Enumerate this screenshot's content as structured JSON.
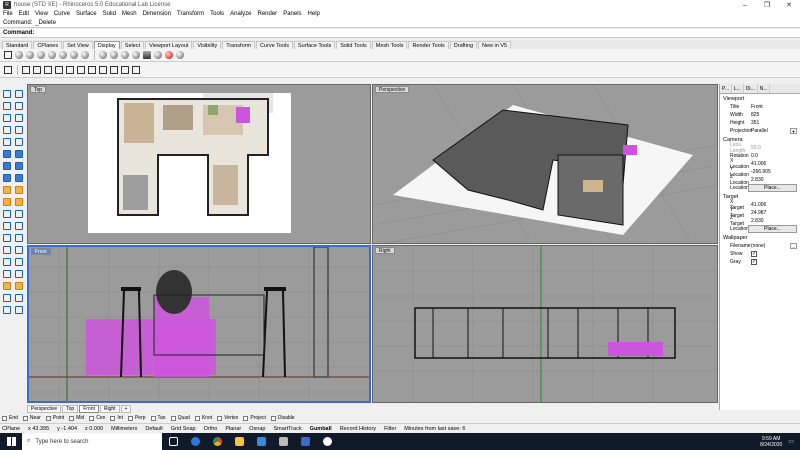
{
  "titlebar": {
    "app_icon": "rhino-icon",
    "title": "house (STD XE) - Rhinoceros 5.0 Educational Lab License",
    "minimize": "–",
    "maximize": "❐",
    "close": "✕"
  },
  "menu": [
    "File",
    "Edit",
    "View",
    "Curve",
    "Surface",
    "Solid",
    "Mesh",
    "Dimension",
    "Transform",
    "Tools",
    "Analyze",
    "Render",
    "Panels",
    "Help"
  ],
  "command": {
    "history_label": "Command:",
    "history_value": "_Delete",
    "prompt_label": "Command:",
    "prompt_value": ""
  },
  "toolbar_tabs": [
    "Standard",
    "CPlanes",
    "Set View",
    "Display",
    "Select",
    "Viewport Layout",
    "Visibility",
    "Transform",
    "Curve Tools",
    "Surface Tools",
    "Solid Tools",
    "Mesh Tools",
    "Render Tools",
    "Drafting",
    "New in V5"
  ],
  "active_toolbar_tab": "Display",
  "viewports": {
    "top": {
      "title": "Top"
    },
    "perspective": {
      "title": "Perspective"
    },
    "front": {
      "title": "Front"
    },
    "right": {
      "title": "Right"
    }
  },
  "viewport_tabs": [
    "Perspective",
    "Top",
    "Front",
    "Right",
    "+"
  ],
  "panel": {
    "tabs": [
      "P...",
      "L...",
      "Di...",
      "N..."
    ],
    "viewport_header": "Viewport",
    "viewport_props": [
      {
        "k": "Title",
        "v": "Front"
      },
      {
        "k": "Width",
        "v": "825"
      },
      {
        "k": "Height",
        "v": "351"
      },
      {
        "k": "Projection",
        "v": "Parallel"
      }
    ],
    "camera_header": "Camera",
    "camera_props": [
      {
        "k": "Lens Length",
        "v": "50.0"
      },
      {
        "k": "Rotation",
        "v": "0.0"
      },
      {
        "k": "X Location",
        "v": "41.006"
      },
      {
        "k": "Y Location",
        "v": "-266.905"
      },
      {
        "k": "Z Location",
        "v": "2.830"
      },
      {
        "k": "Location",
        "v": "Place..."
      }
    ],
    "target_header": "Target",
    "target_props": [
      {
        "k": "X Target",
        "v": "41.006"
      },
      {
        "k": "Y Target",
        "v": "24.987"
      },
      {
        "k": "Z Target",
        "v": "2.830"
      },
      {
        "k": "Location",
        "v": "Place..."
      }
    ],
    "wallpaper_header": "Wallpaper",
    "wallpaper_props": [
      {
        "k": "Filename",
        "v": "(none)"
      },
      {
        "k": "Show",
        "v": "✓"
      },
      {
        "k": "Gray",
        "v": "✓"
      }
    ]
  },
  "osnaps": [
    "End",
    "Near",
    "Point",
    "Mid",
    "Cen",
    "Int",
    "Perp",
    "Tan",
    "Quad",
    "Knot",
    "Vertex",
    "Project",
    "Disable"
  ],
  "status": {
    "cplane": "CPlane",
    "x": "x 43.395",
    "y": "y -1.404",
    "z": "z 0.000",
    "units": "Millimeters",
    "layer": "Default",
    "grid_snap": "Grid Snap",
    "ortho": "Ortho",
    "planar": "Planar",
    "osnap": "Osnap",
    "smarttrack": "SmartTrack",
    "gumball": "Gumball",
    "record_history": "Record History",
    "filter": "Filter",
    "autosave": "Minutes from last save: 6"
  },
  "taskbar": {
    "search_placeholder": "Type here to search",
    "time": "9:59 AM",
    "date": "8/24/2020",
    "apps": [
      "task-view-icon",
      "edge-icon",
      "chrome-icon",
      "file-explorer-icon",
      "mail-icon",
      "rhino-app-icon",
      "photos-icon",
      "zoom-icon"
    ]
  },
  "colors": {
    "accent": "#3a6dc8",
    "magenta": "#cc55dd",
    "viewport_bg": "#9b9b9b"
  }
}
